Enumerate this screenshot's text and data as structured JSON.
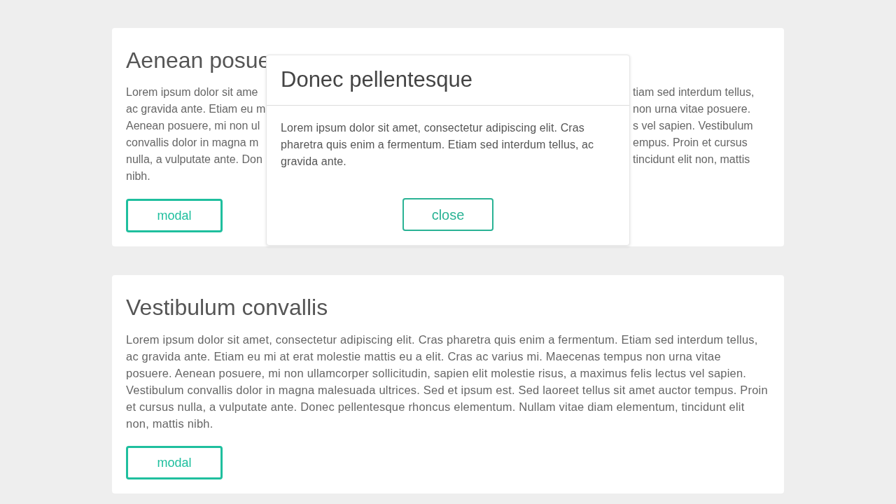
{
  "cards": [
    {
      "kind": "split",
      "title": "Aenean posue",
      "left_lines": [
        "Lorem ipsum dolor sit ame",
        "ac gravida ante. Etiam eu m",
        "Aenean posuere, mi non ul",
        "convallis dolor in magna m",
        "nulla, a vulputate ante. Don",
        "nibh."
      ],
      "right_lines": [
        "tiam sed interdum tellus,",
        "non urna vitae posuere.",
        "s vel sapien. Vestibulum",
        "empus. Proin et cursus",
        "tincidunt elit non, mattis"
      ],
      "button": "modal"
    },
    {
      "kind": "full",
      "title": "Vestibulum convallis",
      "text": "Lorem ipsum dolor sit amet, consectetur adipiscing elit. Cras pharetra quis enim a fermentum. Etiam sed interdum tellus, ac gravida ante. Etiam eu mi at erat molestie mattis eu a elit. Cras ac varius mi. Maecenas tempus non urna vitae posuere. Aenean posuere, mi non ullamcorper sollicitudin, sapien elit molestie risus, a maximus felis lectus vel sapien. Vestibulum convallis dolor in magna malesuada ultrices. Sed et ipsum est. Sed laoreet tellus sit amet auctor tempus. Proin et cursus nulla, a vulputate ante. Donec pellentesque rhoncus elementum. Nullam vitae diam elementum, tincidunt elit non, mattis nibh.",
      "button": "modal"
    }
  ],
  "modal": {
    "title": "Donec pellentesque",
    "text": "Lorem ipsum dolor sit amet, consectetur adipiscing elit. Cras pharetra quis enim a fermentum. Etiam sed interdum tellus, ac gravida ante.",
    "button": "close"
  }
}
